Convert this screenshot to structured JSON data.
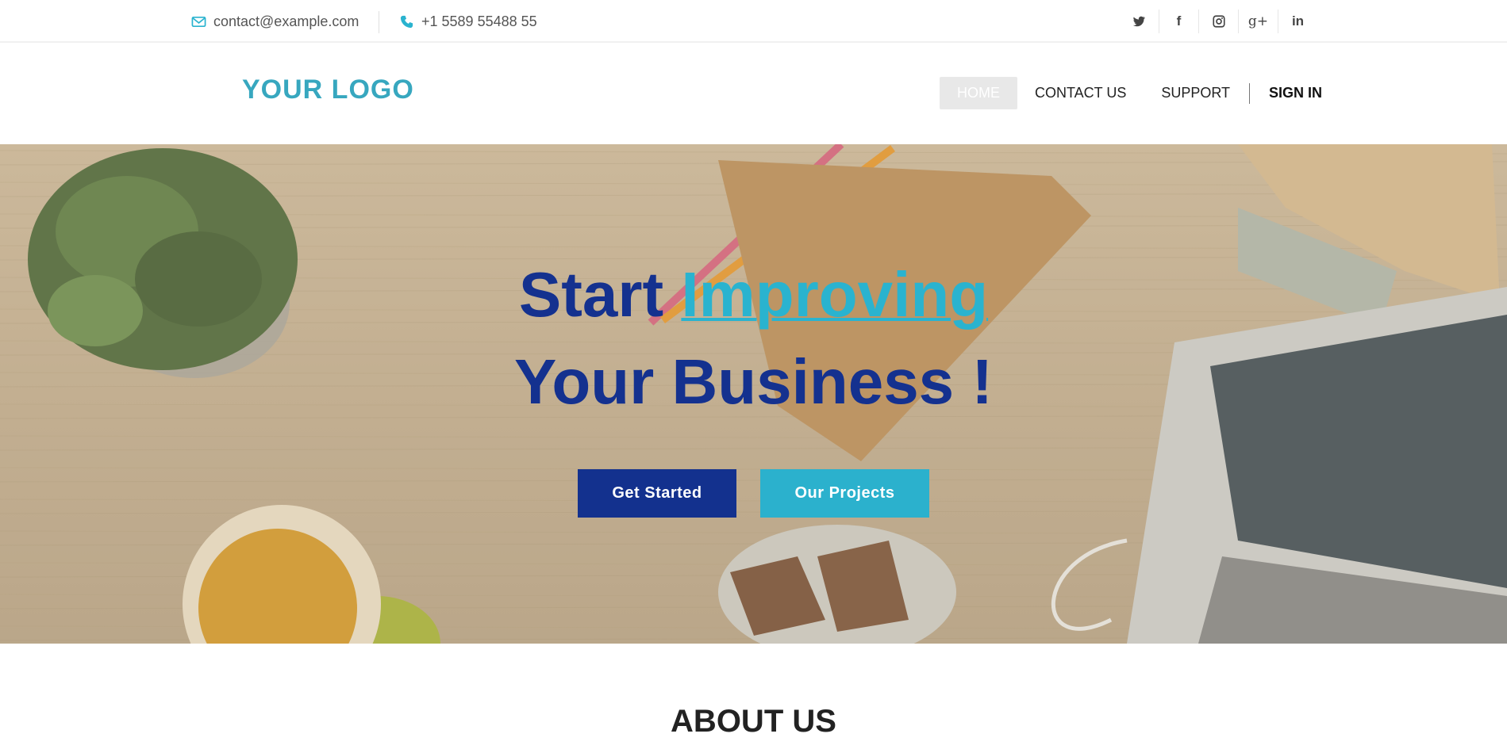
{
  "topbar": {
    "email": "contact@example.com",
    "phone": "+1 5589 55488 55",
    "icons": {
      "email": "envelope-icon",
      "phone": "phone-icon"
    },
    "socials": [
      {
        "name": "twitter-icon"
      },
      {
        "name": "facebook-icon",
        "glyph": "f"
      },
      {
        "name": "instagram-icon"
      },
      {
        "name": "google-plus-icon",
        "glyph": "g+"
      },
      {
        "name": "linkedin-icon",
        "glyph": "in"
      }
    ]
  },
  "header": {
    "logo": "YOUR LOGO",
    "nav": {
      "home": "HOME",
      "contact": "CONTACT US",
      "support": "SUPPORT",
      "signin": "SIGN IN"
    }
  },
  "hero": {
    "title_start": "Start",
    "title_accent": "Improving",
    "title_line2": "Your Business !",
    "primary_button": "Get Started",
    "secondary_button": "Our Projects"
  },
  "about": {
    "title": "ABOUT US"
  },
  "colors": {
    "accent": "#2ab3cf",
    "brand": "#13318e",
    "logo": "#37a7bf"
  }
}
